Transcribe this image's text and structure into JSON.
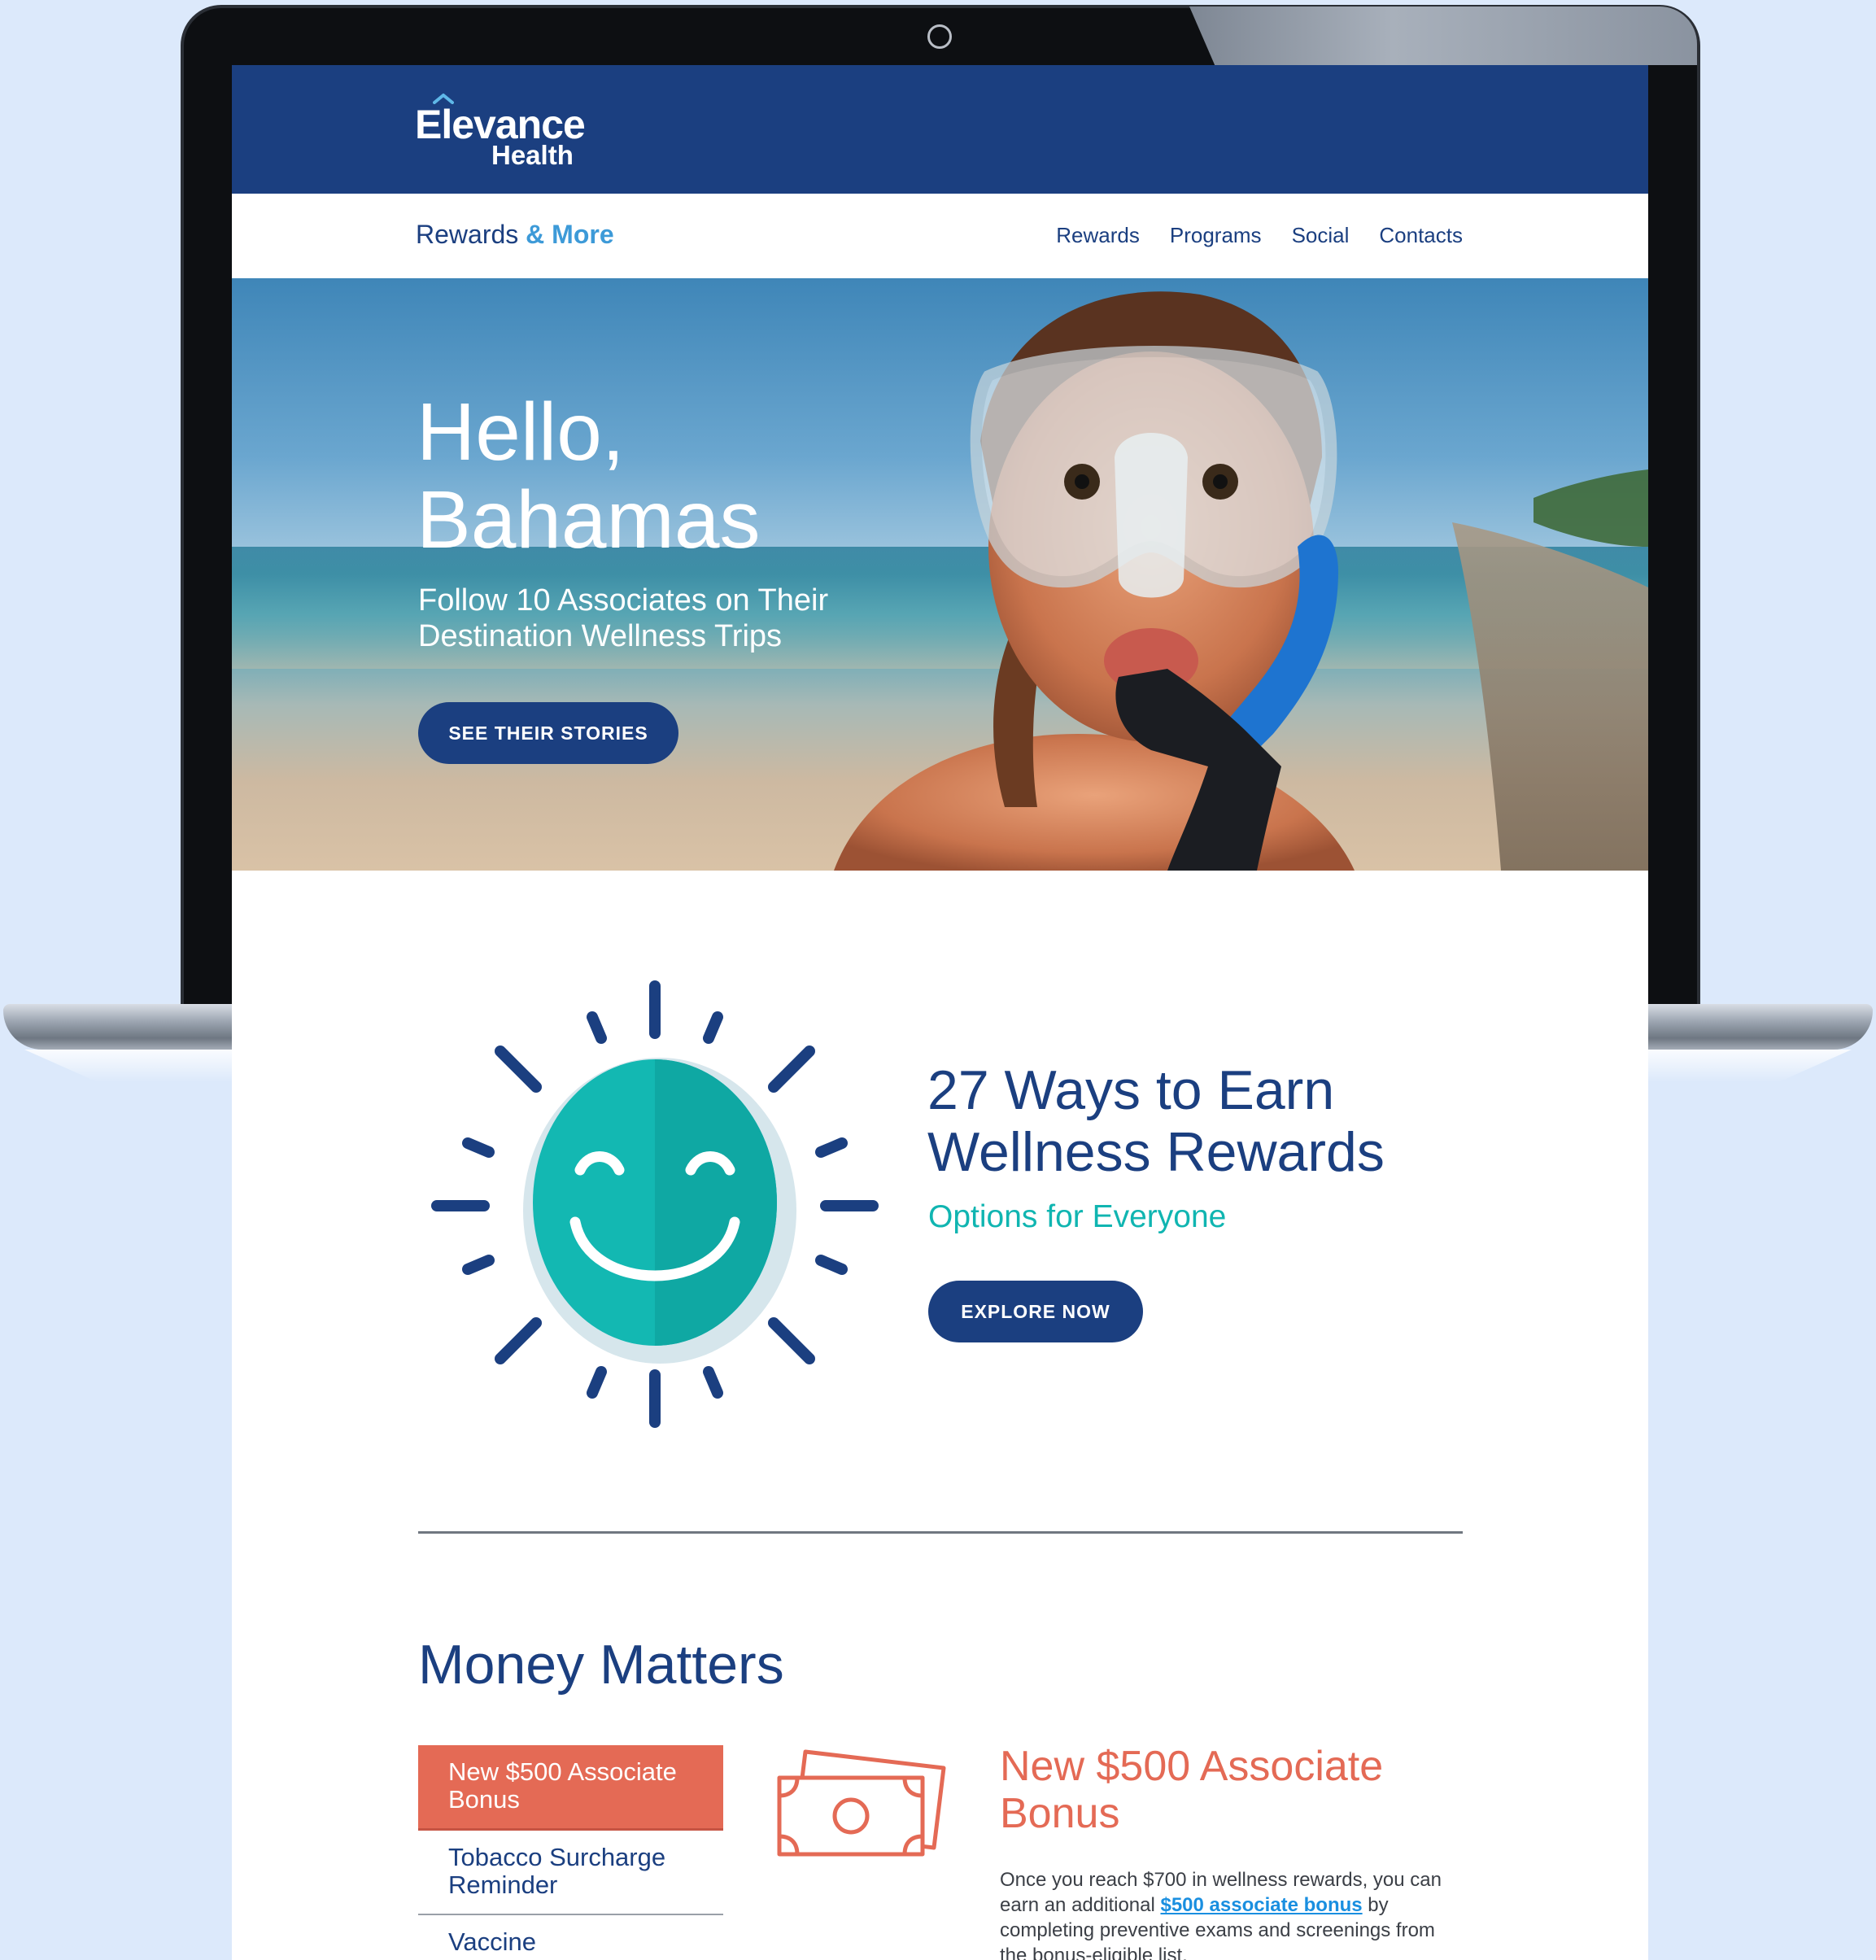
{
  "header": {
    "logo_main": "Elevance",
    "logo_sub": "Health"
  },
  "nav": {
    "brand_part1": "Rewards",
    "brand_part2": " & More",
    "links": [
      "Rewards",
      "Programs",
      "Social",
      "Contacts"
    ]
  },
  "hero": {
    "title_line1": "Hello,",
    "title_line2": "Bahamas",
    "subtitle": "Follow 10 Associates on Their Destination Wellness Trips",
    "button_label": "SEE THEIR STORIES"
  },
  "wellness": {
    "title": "27 Ways to Earn Wellness Rewards",
    "subtitle": "Options for Everyone",
    "button_label": "EXPLORE NOW"
  },
  "money": {
    "title": "Money Matters",
    "menu": [
      {
        "label": "New $500 Associate Bonus",
        "active": true
      },
      {
        "label": "Tobacco Surcharge Reminder",
        "active": false
      },
      {
        "label": "Vaccine",
        "active": false
      }
    ],
    "detail": {
      "title": "New $500 Associate Bonus",
      "body_before": "Once you reach $700 in wellness rewards, you can earn an additional ",
      "body_link": "$500 associate bonus",
      "body_after": " by completing preventive exams and screenings from the bonus-eligible list."
    }
  },
  "colors": {
    "navy": "#1b3f80",
    "teal": "#10b5b1",
    "coral": "#e46a55",
    "link": "#1a8fe0"
  },
  "icons": {
    "logo_mark": "house-roof-icon",
    "sun": "smiling-sun-icon",
    "bills": "money-bills-icon"
  }
}
